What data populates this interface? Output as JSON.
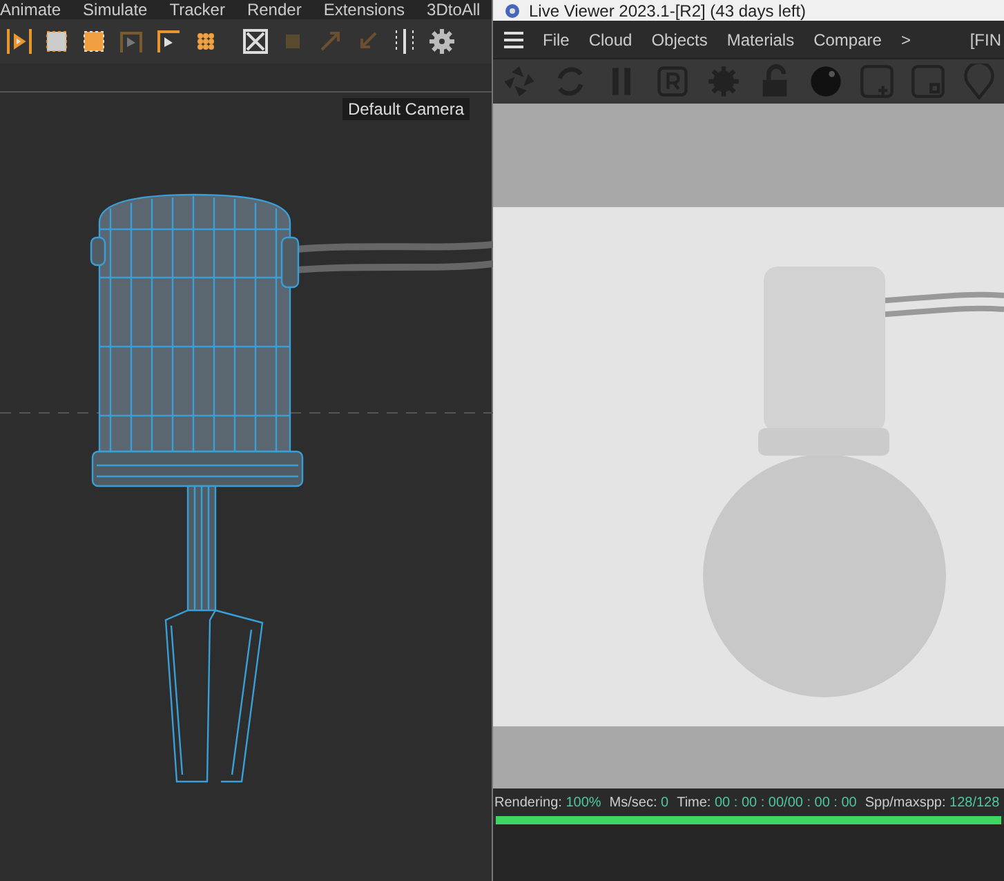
{
  "main_menu": [
    "Animate",
    "Simulate",
    "Tracker",
    "Render",
    "Extensions",
    "3DtoAll"
  ],
  "viewport": {
    "camera_label": "Default Camera"
  },
  "live_viewer": {
    "title": "Live Viewer 2023.1-[R2] (43 days left)",
    "menu": [
      "File",
      "Cloud",
      "Objects",
      "Materials",
      "Compare",
      ">"
    ],
    "menu_right": "[FIN",
    "status": [
      {
        "label": "Rendering:",
        "value": "100%"
      },
      {
        "label": "Ms/sec:",
        "value": "0"
      },
      {
        "label": "Time:",
        "value": "00 : 00 : 00/00 : 00 : 00"
      },
      {
        "label": "Spp/maxspp:",
        "value": "128/128"
      }
    ],
    "progress": {
      "level": 1
    }
  }
}
